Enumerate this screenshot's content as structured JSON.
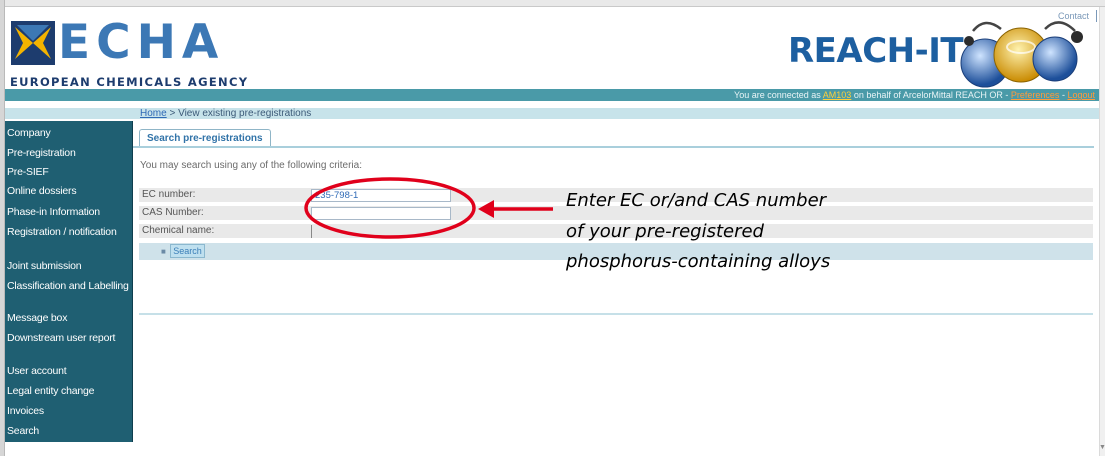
{
  "header": {
    "logo_text": "ECHA",
    "logo_subtitle": "EUROPEAN CHEMICALS AGENCY",
    "app_title": "REACH-IT",
    "contact": "Contact"
  },
  "connection": {
    "prefix": "You are connected as",
    "user": "AM103",
    "middle": "on behalf of ArcelorMittal REACH OR -",
    "preferences": "Preferences",
    "separator": "-",
    "logout": "Logout"
  },
  "breadcrumb": {
    "home": "Home",
    "separator": ">",
    "current": "View existing pre-registrations"
  },
  "sidebar": {
    "items": [
      {
        "label": "Company"
      },
      {
        "label": "Pre-registration"
      },
      {
        "label": "Pre-SIEF"
      },
      {
        "label": "Online dossiers"
      },
      {
        "label": "Phase-in Information"
      },
      {
        "label": "Registration / notification"
      },
      {
        "label": "Joint submission"
      },
      {
        "label": "Classification and Labelling"
      },
      {
        "label": "Message box"
      },
      {
        "label": "Downstream user report"
      },
      {
        "label": "User account"
      },
      {
        "label": "Legal entity change"
      },
      {
        "label": "Invoices"
      },
      {
        "label": "Search"
      }
    ]
  },
  "tab": {
    "label": "Search pre-registrations"
  },
  "form": {
    "intro": "You may search using any of the following criteria:",
    "ec_label": "EC number:",
    "ec_value": "235-798-1",
    "cas_label": "CAS Number:",
    "cas_value": "",
    "name_label": "Chemical name:",
    "name_value": "",
    "search_button": "Search"
  },
  "annotation": {
    "line1": "Enter EC or/and CAS number",
    "line2": "of your pre-registered",
    "line3": "phosphorus-containing alloys",
    "color": "#e0001b"
  }
}
